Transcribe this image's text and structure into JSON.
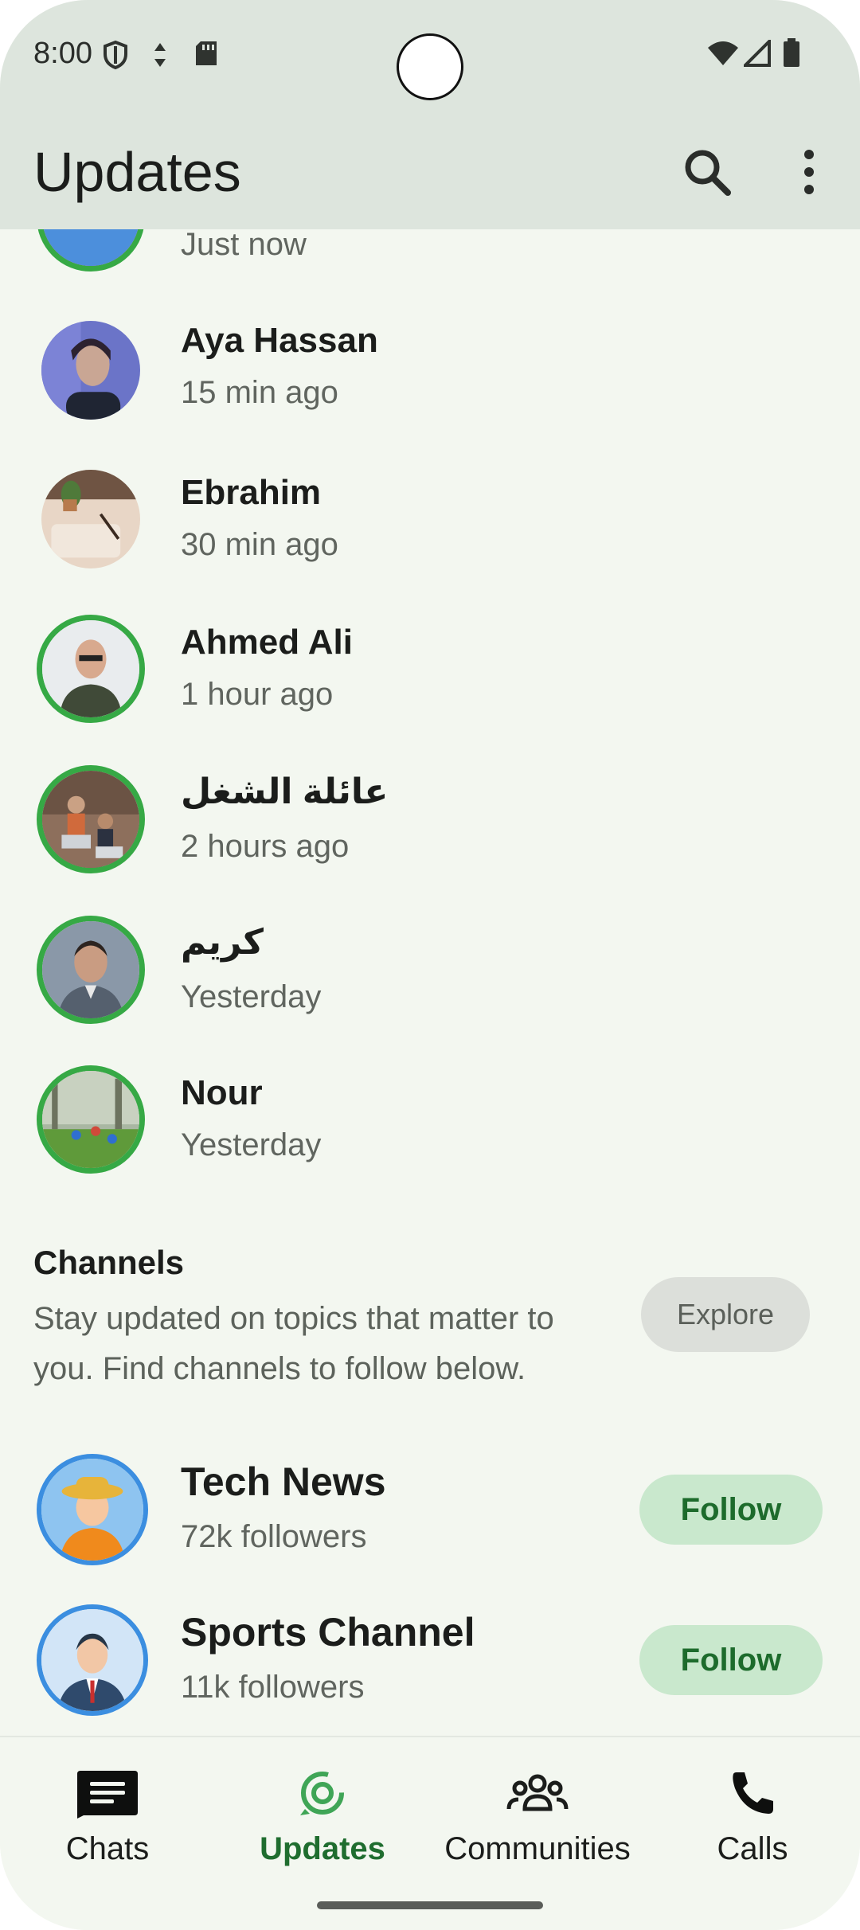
{
  "status": {
    "time": "8:00"
  },
  "header": {
    "title": "Updates"
  },
  "partial_row": {
    "subtitle": "Just now"
  },
  "updates": [
    {
      "name": "Aya Hassan",
      "time": "15 min ago"
    },
    {
      "name": "Ebrahim",
      "time": "30 min ago"
    },
    {
      "name": "Ahmed Ali",
      "time": "1 hour ago"
    },
    {
      "name": "عائلة الشغل",
      "time": "2 hours ago"
    },
    {
      "name": "كريم",
      "time": "Yesterday"
    },
    {
      "name": "Nour",
      "time": "Yesterday"
    }
  ],
  "channels": {
    "title": "Channels",
    "description": "Stay updated on topics that matter to you. Find channels to follow below.",
    "explore_label": "Explore",
    "items": [
      {
        "name": "Tech News",
        "followers": "72k followers",
        "follow_label": "Follow"
      },
      {
        "name": "Sports Channel",
        "followers": "11k followers",
        "follow_label": "Follow"
      }
    ]
  },
  "nav": {
    "items": [
      {
        "label": "Chats",
        "icon": "chat-icon"
      },
      {
        "label": "Updates",
        "icon": "status-icon",
        "active": true
      },
      {
        "label": "Communities",
        "icon": "communities-icon"
      },
      {
        "label": "Calls",
        "icon": "phone-icon"
      }
    ]
  },
  "colors": {
    "accent": "#1f6d2f",
    "ring": "#36a945",
    "follow_bg": "#c9e8cd"
  }
}
